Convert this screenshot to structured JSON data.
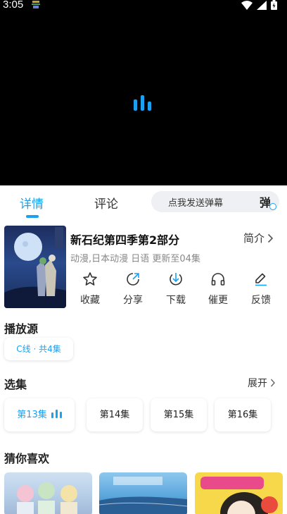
{
  "status": {
    "time": "3:05"
  },
  "tabs": {
    "detail": "详情",
    "comment": "评论"
  },
  "danmaku": {
    "placeholder": "点我发送弹幕",
    "icon_char": "弹"
  },
  "show": {
    "title": "新石纪第四季第2部分",
    "intro_label": "简介",
    "meta": "动漫,日本动漫 日语 更新至04集"
  },
  "actions": [
    {
      "label": "收藏",
      "icon": "star-icon"
    },
    {
      "label": "分享",
      "icon": "share-icon"
    },
    {
      "label": "下载",
      "icon": "download-icon"
    },
    {
      "label": "催更",
      "icon": "headphones-icon"
    },
    {
      "label": "反馈",
      "icon": "edit-icon"
    }
  ],
  "source": {
    "title": "播放源",
    "chip": "C线 · 共4集"
  },
  "episodes": {
    "title": "选集",
    "expand": "展开",
    "items": [
      {
        "label": "第13集",
        "active": true
      },
      {
        "label": "第14集",
        "active": false
      },
      {
        "label": "第15集",
        "active": false
      },
      {
        "label": "第16集",
        "active": false
      }
    ]
  },
  "recommend": {
    "title": "猜你喜欢"
  },
  "colors": {
    "accent": "#1aa2f0",
    "player_bg": "#000000"
  }
}
